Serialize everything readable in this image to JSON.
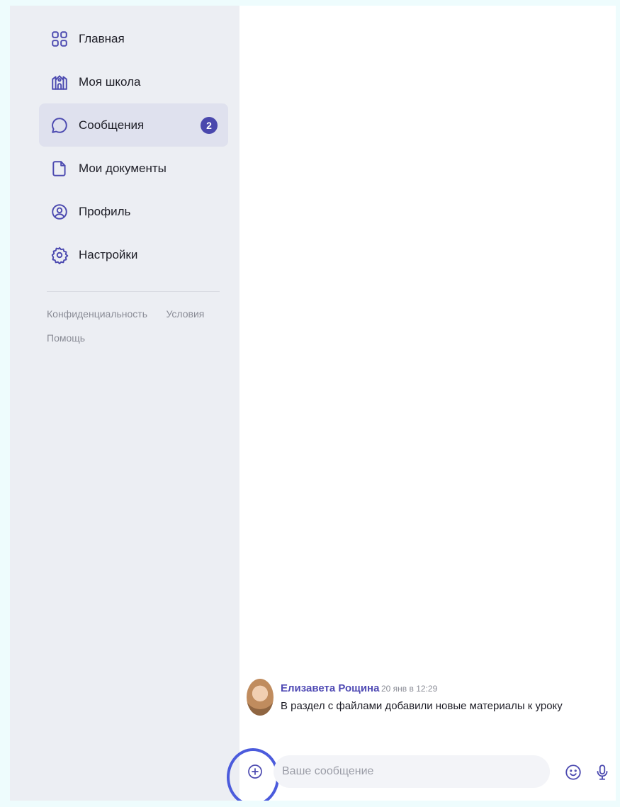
{
  "sidebar": {
    "items": [
      {
        "label": "Главная",
        "icon": "grid-icon",
        "active": false
      },
      {
        "label": "Моя школа",
        "icon": "school-icon",
        "active": false
      },
      {
        "label": "Сообщения",
        "icon": "chat-bubble-icon",
        "active": true,
        "badge": "2"
      },
      {
        "label": "Мои документы",
        "icon": "document-icon",
        "active": false
      },
      {
        "label": "Профиль",
        "icon": "profile-icon",
        "active": false
      },
      {
        "label": "Настройки",
        "icon": "gear-icon",
        "active": false
      }
    ],
    "footer_links": [
      "Конфиденциальность",
      "Условия",
      "Помощь"
    ]
  },
  "chat": {
    "message": {
      "sender": "Елизавета Рощина",
      "time": "20 янв в 12:29",
      "text": "В раздел с файлами добавили новые материалы к уроку"
    },
    "composer": {
      "placeholder": "Ваше сообщение",
      "value": ""
    }
  },
  "colors": {
    "accent": "#4a48ad",
    "sidebar_bg": "#eceef3",
    "active_item_bg": "#dfe1ee",
    "highlight_ring": "#4b5bdc"
  }
}
